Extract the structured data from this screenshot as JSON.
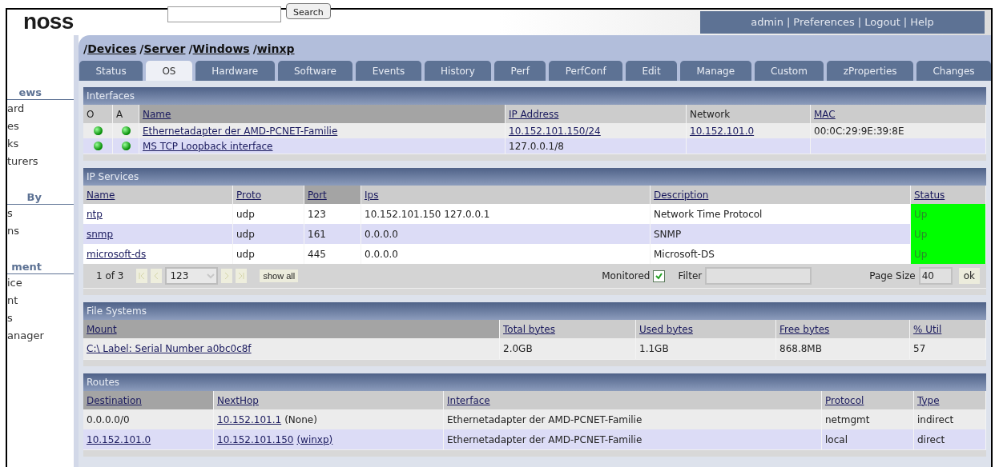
{
  "header": {
    "logo": "noss",
    "search_button": "Search",
    "user_links": [
      {
        "label": "admin"
      },
      {
        "label": "Preferences"
      },
      {
        "label": "Logout"
      },
      {
        "label": "Help"
      }
    ],
    "user_link_separator": "|"
  },
  "sidebar": [
    {
      "heading": "ews",
      "items": [
        "ard",
        "es",
        "ks",
        "turers"
      ]
    },
    {
      "heading": "By",
      "items": [
        "s",
        "ns"
      ]
    },
    {
      "heading": "ment",
      "items": [
        "ice",
        "nt",
        "s",
        "anager"
      ]
    }
  ],
  "breadcrumb": {
    "separator": "/",
    "items": [
      "Devices",
      "Server",
      "Windows",
      "winxp"
    ]
  },
  "tabs": [
    {
      "label": "Status",
      "selected": false
    },
    {
      "label": "OS",
      "selected": true
    },
    {
      "label": "Hardware",
      "selected": false
    },
    {
      "label": "Software",
      "selected": false
    },
    {
      "label": "Events",
      "selected": false
    },
    {
      "label": "History",
      "selected": false
    },
    {
      "label": "Perf",
      "selected": false
    },
    {
      "label": "PerfConf",
      "selected": false
    },
    {
      "label": "Edit",
      "selected": false
    },
    {
      "label": "Manage",
      "selected": false
    },
    {
      "label": "Custom",
      "selected": false
    },
    {
      "label": "zProperties",
      "selected": false
    },
    {
      "label": "Changes",
      "selected": false
    }
  ],
  "sections": [
    {
      "kind": "interfaces",
      "title": "Interfaces",
      "columns": [
        {
          "label": "O",
          "sorted": false,
          "link": false
        },
        {
          "label": "A",
          "sorted": false,
          "link": false
        },
        {
          "label": "Name",
          "sorted": true,
          "link": true
        },
        {
          "label": "IP Address",
          "sorted": false,
          "link": true
        },
        {
          "label": "Network",
          "sorted": false,
          "link": false
        },
        {
          "label": "MAC",
          "sorted": false,
          "link": true
        }
      ],
      "rows": [
        [
          {
            "kind": "dot",
            "up": true
          },
          {
            "kind": "dot",
            "up": true
          },
          {
            "text": "Ethernetadapter der AMD-PCNET-Familie",
            "link": true
          },
          {
            "text": "10.152.101.150/24",
            "link": true
          },
          {
            "text": "10.152.101.0",
            "link": true
          },
          {
            "text": "00:0C:29:9E:39:8E",
            "link": false
          }
        ],
        [
          {
            "kind": "dot",
            "up": true
          },
          {
            "kind": "dot",
            "up": true
          },
          {
            "text": "MS TCP Loopback interface",
            "link": true
          },
          {
            "text": "127.0.0.1/8",
            "link": false
          },
          {
            "kind": "empty"
          },
          {
            "kind": "empty"
          }
        ]
      ]
    },
    {
      "kind": "services",
      "title": "IP Services",
      "columns": [
        {
          "label": "Name",
          "sorted": false,
          "link": true
        },
        {
          "label": "Proto",
          "sorted": false,
          "link": true
        },
        {
          "label": "Port",
          "sorted": true,
          "link": true
        },
        {
          "label": "Ips",
          "sorted": false,
          "link": true
        },
        {
          "label": "Description",
          "sorted": false,
          "link": true
        },
        {
          "label": "Status",
          "sorted": false,
          "link": true
        }
      ],
      "rows": [
        [
          {
            "text": "ntp",
            "link": true
          },
          {
            "text": "udp",
            "link": false
          },
          {
            "text": "123",
            "link": false
          },
          {
            "text": "10.152.101.150 127.0.0.1",
            "link": false
          },
          {
            "text": "Network Time Protocol",
            "link": false
          },
          {
            "text": "Up",
            "link": false,
            "color": "#00ff00"
          }
        ],
        [
          {
            "text": "snmp",
            "link": true
          },
          {
            "text": "udp",
            "link": false
          },
          {
            "text": "161",
            "link": false
          },
          {
            "text": "0.0.0.0",
            "link": false
          },
          {
            "text": "SNMP",
            "link": false
          },
          {
            "text": "Up",
            "link": false,
            "color": "#00ff00"
          }
        ],
        [
          {
            "text": "microsoft-ds",
            "link": true
          },
          {
            "text": "udp",
            "link": false
          },
          {
            "text": "445",
            "link": false
          },
          {
            "text": "0.0.0.0",
            "link": false
          },
          {
            "text": "Microsoft-DS",
            "link": false
          },
          {
            "text": "Up",
            "link": false,
            "color": "#00ff00"
          }
        ]
      ],
      "pager": {
        "position": "1 of 3",
        "page": "123",
        "show_all": "show all",
        "monitored_label": "Monitored",
        "monitored": true,
        "filter_label": "Filter",
        "page_size_label": "Page Size",
        "page_size": "40",
        "ok": "ok"
      }
    },
    {
      "kind": "filesystems",
      "title": "File Systems",
      "columns": [
        {
          "label": "Mount",
          "sorted": true,
          "link": true
        },
        {
          "label": "Total bytes",
          "sorted": false,
          "link": true
        },
        {
          "label": "Used bytes",
          "sorted": false,
          "link": true
        },
        {
          "label": "Free bytes",
          "sorted": false,
          "link": true
        },
        {
          "label": "% Util",
          "sorted": false,
          "link": true
        }
      ],
      "rows": [
        [
          {
            "text": "C:\\ Label: Serial Number a0bc0c8f",
            "link": true
          },
          {
            "text": "2.0GB",
            "link": false
          },
          {
            "text": "1.1GB",
            "link": false
          },
          {
            "text": "868.8MB",
            "link": false
          },
          {
            "text": "57",
            "link": false
          }
        ]
      ]
    },
    {
      "kind": "routes",
      "title": "Routes",
      "columns": [
        {
          "label": "Destination",
          "sorted": true,
          "link": true
        },
        {
          "label": "NextHop",
          "sorted": false,
          "link": true
        },
        {
          "label": "Interface",
          "sorted": false,
          "link": true
        },
        {
          "label": "Protocol",
          "sorted": false,
          "link": true
        },
        {
          "label": "Type",
          "sorted": false,
          "link": true
        }
      ],
      "rows": [
        [
          {
            "text": "0.0.0.0/0",
            "link": false
          },
          {
            "parts": [
              {
                "text": "10.152.101.1",
                "link": true
              },
              {
                "text": "(None)",
                "link": false
              }
            ]
          },
          {
            "text": "Ethernetadapter der AMD-PCNET-Familie",
            "link": false
          },
          {
            "text": "netmgmt",
            "link": false
          },
          {
            "text": "indirect",
            "link": false
          }
        ],
        [
          {
            "text": "10.152.101.0",
            "link": true
          },
          {
            "parts": [
              {
                "text": "10.152.101.150",
                "link": true
              },
              {
                "text": "(winxp)",
                "link": true
              }
            ]
          },
          {
            "text": "Ethernetadapter der AMD-PCNET-Familie",
            "link": false
          },
          {
            "text": "local",
            "link": false
          },
          {
            "text": "direct",
            "link": false
          }
        ]
      ]
    }
  ]
}
